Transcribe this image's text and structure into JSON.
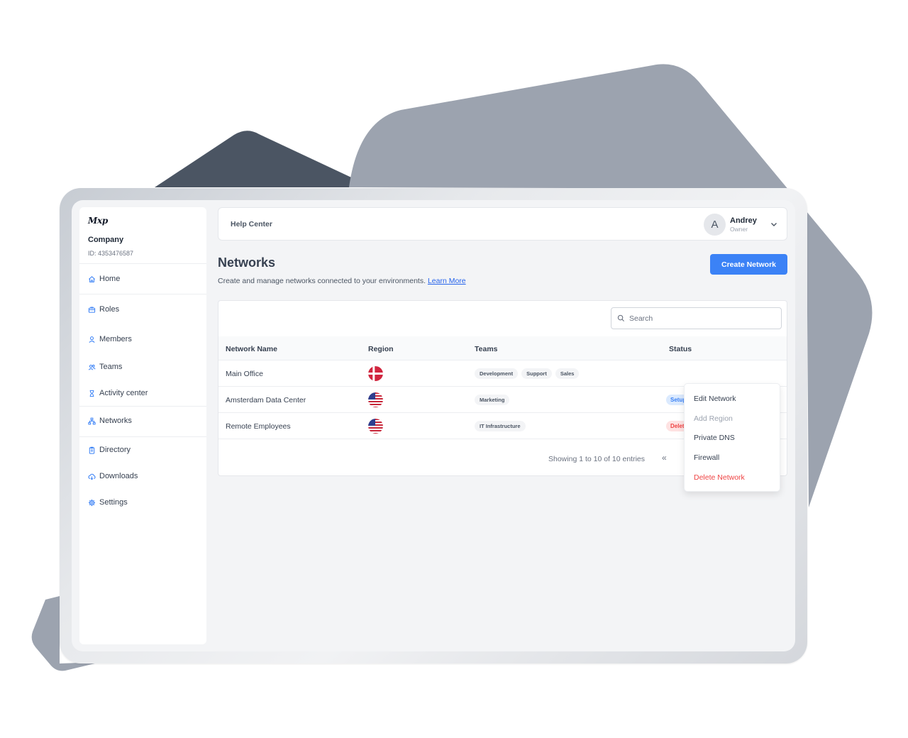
{
  "brand": {
    "logo": "Mxp",
    "company": "Company",
    "company_id": "ID: 4353476587"
  },
  "sidebar": {
    "items": [
      {
        "label": "Home",
        "icon": "home-icon"
      },
      {
        "label": "Roles",
        "icon": "briefcase-icon"
      },
      {
        "label": "Members",
        "icon": "user-icon"
      },
      {
        "label": "Teams",
        "icon": "users-icon"
      },
      {
        "label": "Activity center",
        "icon": "hourglass-icon"
      },
      {
        "label": "Networks",
        "icon": "network-icon"
      },
      {
        "label": "Directory",
        "icon": "clipboard-icon"
      },
      {
        "label": "Downloads",
        "icon": "cloud-download-icon"
      },
      {
        "label": "Settings",
        "icon": "gear-icon"
      }
    ],
    "active": "Networks"
  },
  "header": {
    "help_center": "Help Center",
    "user": {
      "initial": "A",
      "name": "Andrey",
      "role": "Owner"
    }
  },
  "page": {
    "title": "Networks",
    "description": "Create and manage networks connected to your environments.",
    "learn_more": "Learn More",
    "create_button": "Create Network"
  },
  "search": {
    "placeholder": "Search"
  },
  "table": {
    "columns": [
      "Network Name",
      "Region",
      "Teams",
      "Status"
    ],
    "rows": [
      {
        "name": "Main Office",
        "region": "denmark-flag",
        "teams": [
          "Development",
          "Support",
          "Sales"
        ],
        "status": ""
      },
      {
        "name": "Amsterdam Data Center",
        "region": "usa-flag",
        "teams": [
          "Marketing"
        ],
        "status": "Setup"
      },
      {
        "name": "Remote Employees",
        "region": "usa-flag",
        "teams": [
          "IT Infrastructure"
        ],
        "status": "Deleting"
      }
    ],
    "showing": "Showing 1 to 10 of 10 entries",
    "prev_page": "«"
  },
  "menu": {
    "items": [
      {
        "label": "Edit Network",
        "state": "normal"
      },
      {
        "label": "Add Region",
        "state": "disabled"
      },
      {
        "label": "Private DNS",
        "state": "normal"
      },
      {
        "label": "Firewall",
        "state": "normal"
      },
      {
        "label": "Delete Network",
        "state": "danger"
      }
    ]
  },
  "colors": {
    "accent": "#3b82f6",
    "danger": "#ef4444",
    "frame_dark": "#4b5563",
    "frame_light": "#9ca3af"
  }
}
